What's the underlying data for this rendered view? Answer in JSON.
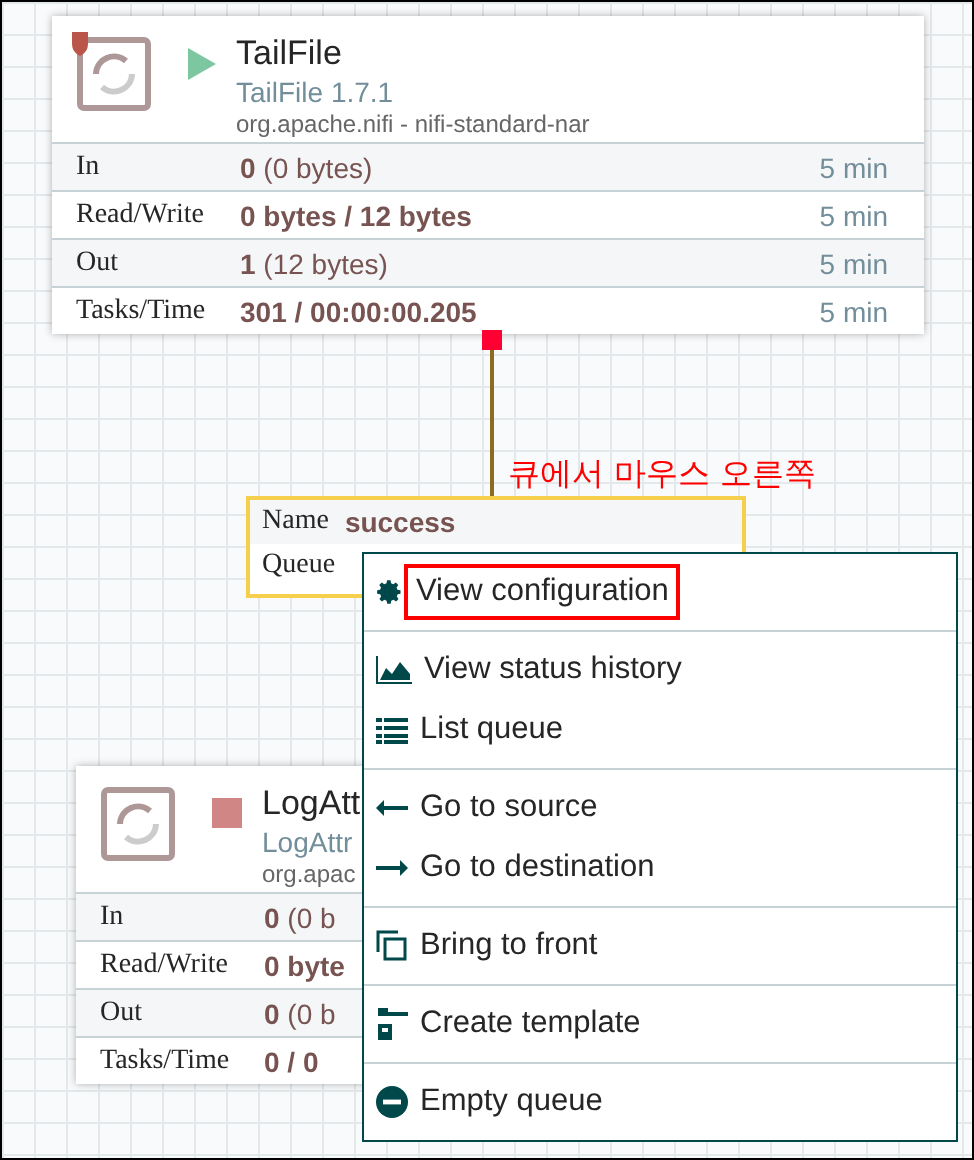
{
  "source_processor": {
    "name": "TailFile",
    "type": "TailFile 1.7.1",
    "bundle": "org.apache.nifi - nifi-standard-nar",
    "running": true,
    "restricted": true,
    "stats": [
      {
        "label": "In",
        "count": "0",
        "detail": "(0 bytes)",
        "window": "5 min"
      },
      {
        "label": "Read/Write",
        "count": "0 bytes / 12 bytes",
        "window": "5 min"
      },
      {
        "label": "Out",
        "count": "1",
        "detail": "(12 bytes)",
        "window": "5 min"
      },
      {
        "label": "Tasks/Time",
        "count": "301 / 00:00:00.205",
        "window": "5 min"
      }
    ]
  },
  "annotation": "큐에서 마우스 오른쪽",
  "connection": {
    "name_label": "Name",
    "name": "success",
    "queued_label": "Queue"
  },
  "target_processor": {
    "name": "LogAtt",
    "type": "LogAttr",
    "bundle": "org.apac",
    "running": false,
    "restricted": false,
    "stats": [
      {
        "label": "In",
        "count": "0",
        "detail": "(0 b"
      },
      {
        "label": "Read/Write",
        "count": "0 byte"
      },
      {
        "label": "Out",
        "count": "0",
        "detail": "(0 b"
      },
      {
        "label": "Tasks/Time",
        "count": "0 / 0"
      }
    ]
  },
  "context_menu": {
    "groups": [
      [
        {
          "label": "View configuration",
          "selected": true
        }
      ],
      [
        {
          "label": "View status history",
          "selected": false
        },
        {
          "label": "List queue",
          "selected": false
        }
      ],
      [
        {
          "label": "Go to source",
          "selected": false
        },
        {
          "label": "Go to destination",
          "selected": false
        }
      ],
      [
        {
          "label": "Bring to front",
          "selected": false
        }
      ],
      [
        {
          "label": "Create template",
          "selected": false
        }
      ],
      [
        {
          "label": "Empty queue",
          "selected": false
        }
      ]
    ]
  }
}
